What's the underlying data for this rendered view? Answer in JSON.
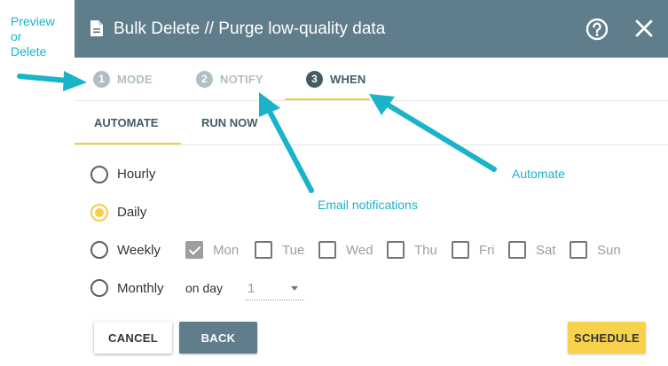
{
  "annotations": {
    "preview": [
      "Preview",
      "or",
      "Delete"
    ],
    "email": "Email notifications",
    "automate": "Automate"
  },
  "dialog": {
    "title": "Bulk Delete // Purge low-quality data",
    "steps": [
      {
        "num": "1",
        "label": "MODE",
        "state": "inactive"
      },
      {
        "num": "2",
        "label": "NOTIFY",
        "state": "inactive"
      },
      {
        "num": "3",
        "label": "WHEN",
        "state": "active"
      }
    ],
    "tabs": [
      {
        "label": "AUTOMATE",
        "active": true
      },
      {
        "label": "RUN NOW",
        "active": false
      }
    ],
    "frequency": {
      "options": [
        "Hourly",
        "Daily",
        "Weekly",
        "Monthly"
      ],
      "selected": "Daily"
    },
    "weekdays": [
      {
        "label": "Mon",
        "checked": true
      },
      {
        "label": "Tue",
        "checked": false
      },
      {
        "label": "Wed",
        "checked": false
      },
      {
        "label": "Thu",
        "checked": false
      },
      {
        "label": "Fri",
        "checked": false
      },
      {
        "label": "Sat",
        "checked": false
      },
      {
        "label": "Sun",
        "checked": false
      }
    ],
    "monthly": {
      "on_day_label": "on day",
      "day_value": "1"
    },
    "buttons": {
      "cancel": "CANCEL",
      "back": "BACK",
      "schedule": "SCHEDULE"
    }
  },
  "colors": {
    "header": "#607d8b",
    "accent": "#f5cd47",
    "annotation": "#1ab3c9",
    "step_active": "#455a64",
    "step_inactive": "#b0bec5"
  },
  "icons": [
    "document-icon",
    "help-icon",
    "close-icon",
    "chevron-down-icon"
  ]
}
